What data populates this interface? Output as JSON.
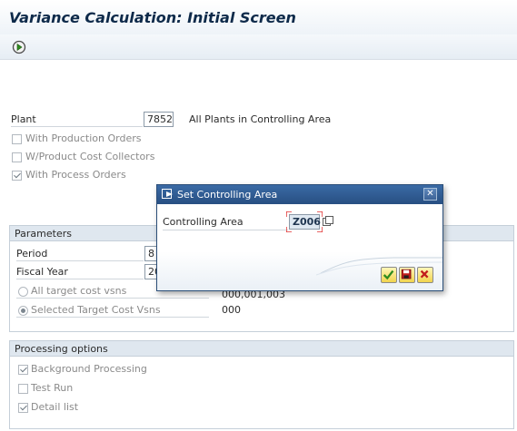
{
  "window": {
    "title": "Variance Calculation: Initial Screen"
  },
  "toolbar": {
    "execute_icon": "execute-icon"
  },
  "selection": {
    "plant_label": "Plant",
    "plant_value": "7852",
    "plant_description": "All Plants in Controlling Area",
    "checkboxes": [
      {
        "label": "With Production Orders",
        "checked": false
      },
      {
        "label": "W/Product Cost Collectors",
        "checked": false
      },
      {
        "label": "With Process Orders",
        "checked": true
      }
    ]
  },
  "parameters": {
    "header": "Parameters",
    "period_label": "Period",
    "period_value": "8",
    "fiscal_year_label": "Fiscal Year",
    "fiscal_year_value": "20",
    "radio_all_label": "All target cost vsns",
    "radio_all_value": "000,001,003",
    "radio_selected_label": "Selected Target Cost Vsns",
    "radio_selected_value": "000"
  },
  "processing": {
    "header": "Processing options",
    "options": [
      {
        "label": "Background Processing",
        "checked": true
      },
      {
        "label": "Test Run",
        "checked": false
      },
      {
        "label": "Detail list",
        "checked": true
      }
    ]
  },
  "dialog": {
    "title": "Set Controlling Area",
    "field_label": "Controlling Area",
    "field_value": "Z006",
    "buttons": [
      "continue",
      "save",
      "cancel"
    ]
  },
  "colors": {
    "dialog_title_bar": "#284f82",
    "group_header": "#dfe7ef",
    "ok_icon": "#2e8b1f",
    "cancel_icon": "#c21d1d"
  }
}
